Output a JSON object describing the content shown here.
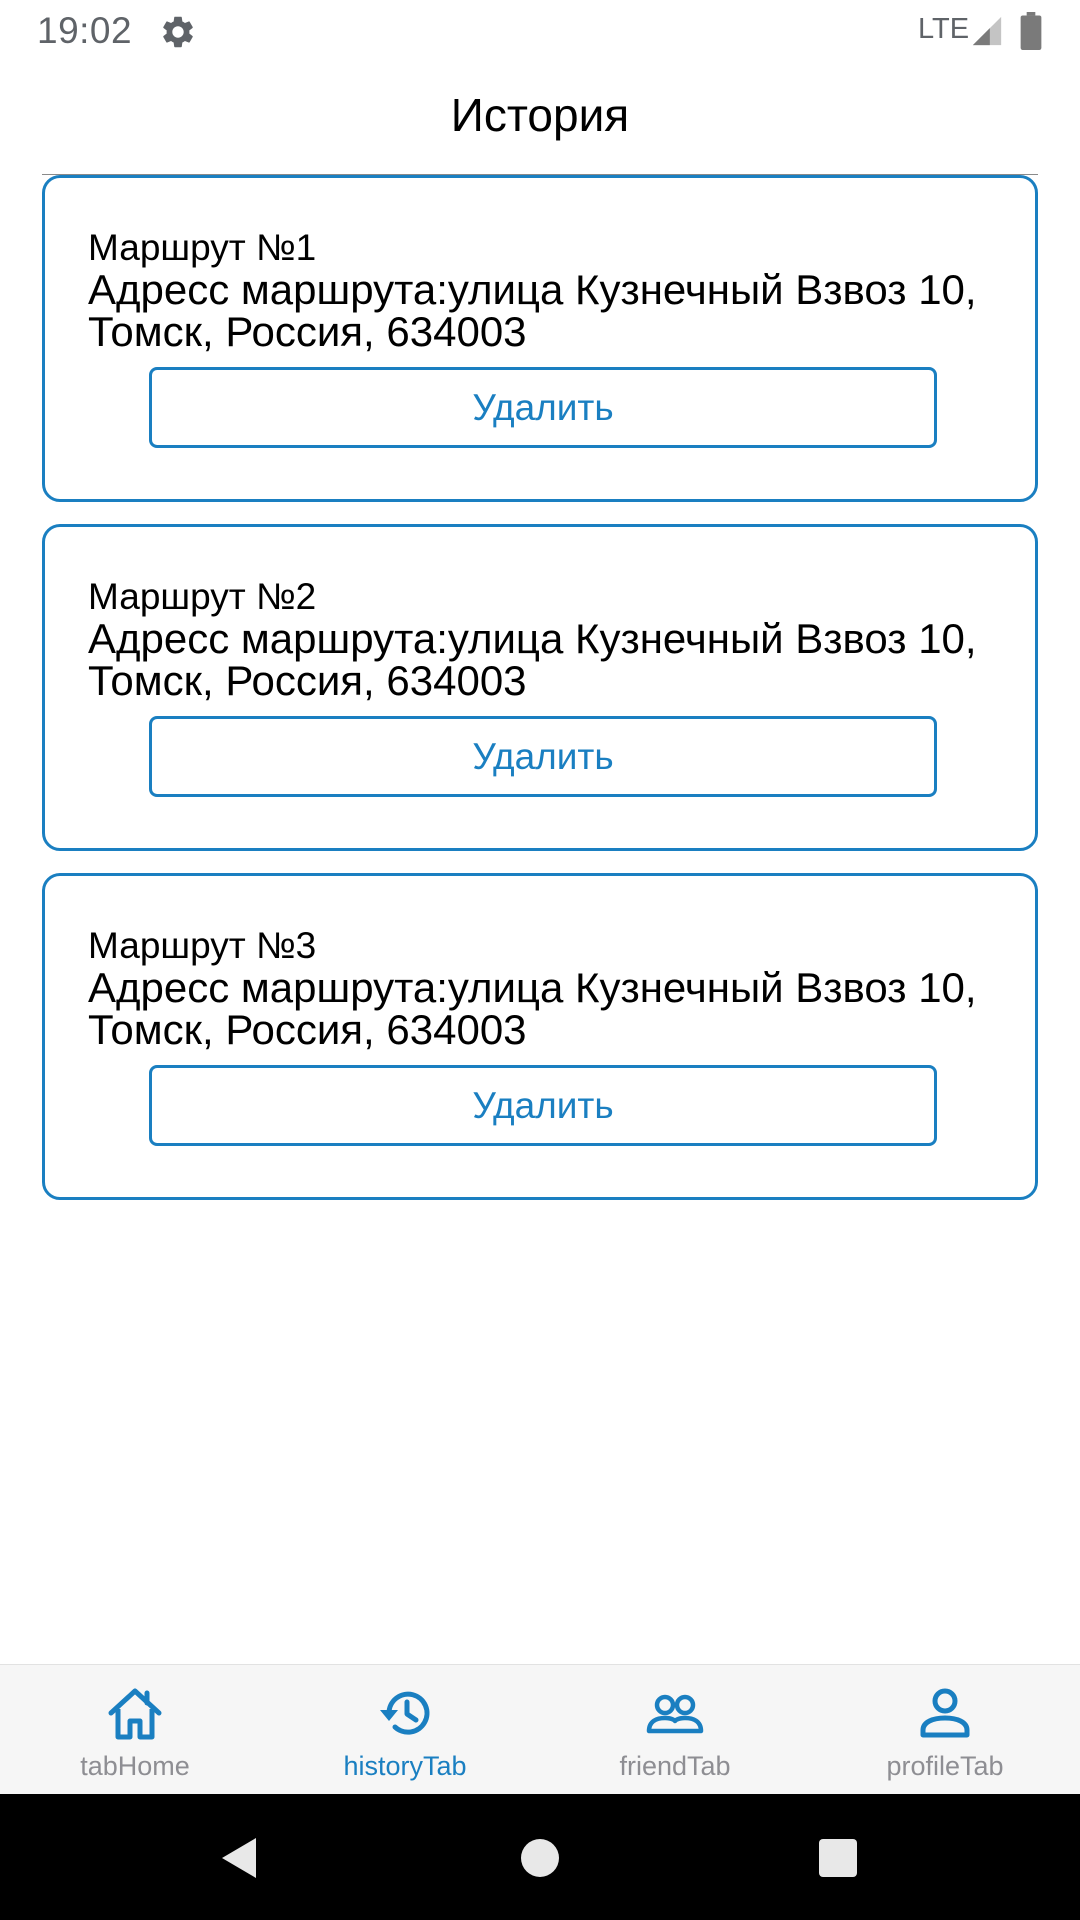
{
  "status_bar": {
    "time": "19:02",
    "network": "LTE",
    "icons": [
      "gear-icon",
      "signal-icon",
      "battery-icon"
    ]
  },
  "header": {
    "title": "История"
  },
  "routes": [
    {
      "title": "Маршрут №1",
      "address": "Адресс маршрута:улица Кузнечный Взвоз 10, Томск, Россия, 634003",
      "delete_label": "Удалить"
    },
    {
      "title": "Маршрут №2",
      "address": "Адресс маршрута:улица Кузнечный Взвоз 10, Томск, Россия, 634003",
      "delete_label": "Удалить"
    },
    {
      "title": "Маршрут №3",
      "address": "Адресс маршрута:улица Кузнечный Взвоз 10, Томск, Россия, 634003",
      "delete_label": "Удалить"
    }
  ],
  "tab_bar": {
    "tabs": [
      {
        "label": "tabHome",
        "icon": "home-icon",
        "active": false
      },
      {
        "label": "historyTab",
        "icon": "history-icon",
        "active": true
      },
      {
        "label": "friendTab",
        "icon": "friends-icon",
        "active": false
      },
      {
        "label": "profileTab",
        "icon": "profile-icon",
        "active": false
      }
    ]
  },
  "nav_bar": {
    "icons": [
      "back-icon",
      "home-circle-icon",
      "recents-icon"
    ]
  },
  "colors": {
    "accent": "#1a7fc1",
    "inactive_tab": "#8e8e93",
    "tab_bar_bg": "#f6f6f6",
    "text": "#000000",
    "status_text": "#5f6368"
  }
}
